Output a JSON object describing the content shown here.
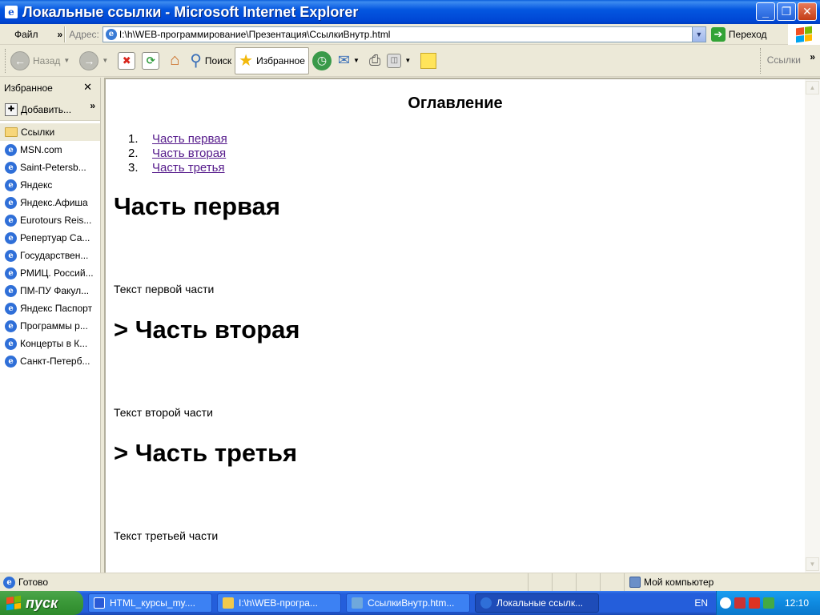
{
  "window": {
    "title": "Локальные ссылки - Microsoft Internet Explorer"
  },
  "menu": {
    "file": "Файл"
  },
  "address_bar": {
    "label": "Адрес:",
    "url": "I:\\h\\WEB-программирование\\Презентация\\СсылкиВнутр.html",
    "go_label": "Переход"
  },
  "toolbar": {
    "back": "Назад",
    "search": "Поиск",
    "favorites": "Избранное",
    "links": "Ссылки"
  },
  "favorites_pane": {
    "title": "Избранное",
    "add": "Добавить...",
    "items": [
      {
        "label": "Ссылки",
        "type": "folder"
      },
      {
        "label": "MSN.com",
        "type": "link"
      },
      {
        "label": "Saint-Petersb...",
        "type": "link"
      },
      {
        "label": "Яндекс",
        "type": "link"
      },
      {
        "label": "Яндекс.Афиша",
        "type": "link"
      },
      {
        "label": "Eurotours Reis...",
        "type": "link"
      },
      {
        "label": "Репертуар Са...",
        "type": "link"
      },
      {
        "label": "Государствен...",
        "type": "link"
      },
      {
        "label": "РМИЦ. Россий...",
        "type": "link"
      },
      {
        "label": "ПМ-ПУ Факул...",
        "type": "link"
      },
      {
        "label": "Яндекс Паспорт",
        "type": "link"
      },
      {
        "label": "Программы р...",
        "type": "link"
      },
      {
        "label": "Концерты в К...",
        "type": "link"
      },
      {
        "label": "Санкт-Петерб...",
        "type": "link"
      }
    ]
  },
  "page": {
    "toc_title": "Оглавление",
    "toc": [
      {
        "num": "1.",
        "label": "Часть первая"
      },
      {
        "num": "2.",
        "label": "Часть вторая"
      },
      {
        "num": "3.",
        "label": "Часть третья"
      }
    ],
    "sections": [
      {
        "heading": "Часть первая",
        "text": "Текст первой части"
      },
      {
        "heading": "> Часть вторая",
        "text": "Текст второй части"
      },
      {
        "heading": "> Часть третья",
        "text": "Текст третьей части"
      }
    ]
  },
  "status_bar": {
    "status": "Готово",
    "zone": "Мой компьютер"
  },
  "taskbar": {
    "start": "пуск",
    "tasks": [
      {
        "label": "HTML_курсы_my....",
        "active": false,
        "color": "#2a5bd7"
      },
      {
        "label": "I:\\h\\WEB-програ...",
        "active": false,
        "color": "#f2c94c"
      },
      {
        "label": "СсылкиВнутр.htm...",
        "active": false,
        "color": "#6fa8dc"
      },
      {
        "label": "Локальные ссылк...",
        "active": true,
        "color": "#2f6fd8"
      }
    ],
    "lang": "EN",
    "clock": "12:10"
  }
}
